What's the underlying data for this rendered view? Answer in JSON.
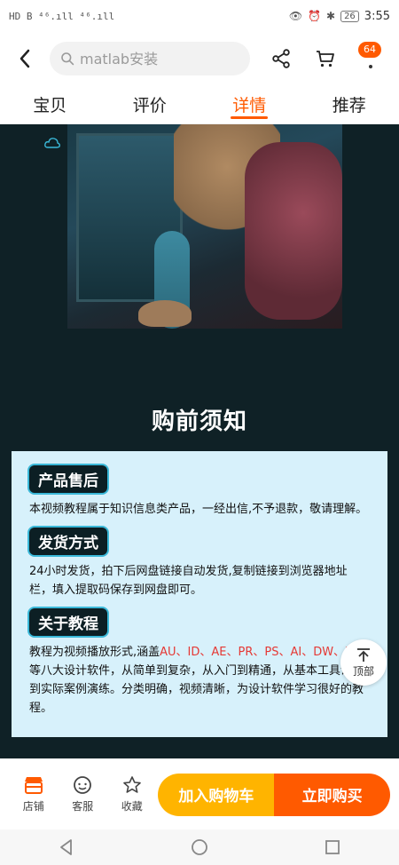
{
  "status_bar": {
    "left_indicators": "HD B ⁴⁶.ıll ⁴⁶.ıll",
    "battery": "26",
    "time": "3:55"
  },
  "top_nav": {
    "search_placeholder": "matlab安装",
    "cart_badge": "64"
  },
  "tabs": [
    {
      "label": "宝贝",
      "active": false
    },
    {
      "label": "评价",
      "active": false
    },
    {
      "label": "详情",
      "active": true
    },
    {
      "label": "推荐",
      "active": false
    }
  ],
  "content": {
    "section_title": "购前须知",
    "blocks": [
      {
        "label": "产品售后",
        "text": "本视频教程属于知识信息类产品，一经出信,不予退款，敬请理解。"
      },
      {
        "label": "发货方式",
        "text": "24小时发货，拍下后网盘链接自动发货,复制链接到浏览器地址栏，填入提取码保存到网盘即可。"
      },
      {
        "label": "关于教程",
        "text_prefix": "教程为视频播放形式,涵盖",
        "text_highlight": "AU、ID、AE、PR、PS、AI、DW、LR",
        "text_suffix": "等八大设计软件，从简单到复杂，从入门到精通，从基本工具讲解到实际案例演练。分类明确，视频清晰，为设计软件学习很好的教程。"
      }
    ],
    "back_top_label": "顶部"
  },
  "bottom_bar": {
    "shop_label": "店铺",
    "service_label": "客服",
    "favorite_label": "收藏",
    "add_cart_label": "加入购物车",
    "buy_now_label": "立即购买"
  },
  "colors": {
    "accent": "#ff5a00",
    "cart_button": "#ffb400",
    "panel_bg": "#d7f1fb",
    "page_bg": "#0f2126"
  }
}
